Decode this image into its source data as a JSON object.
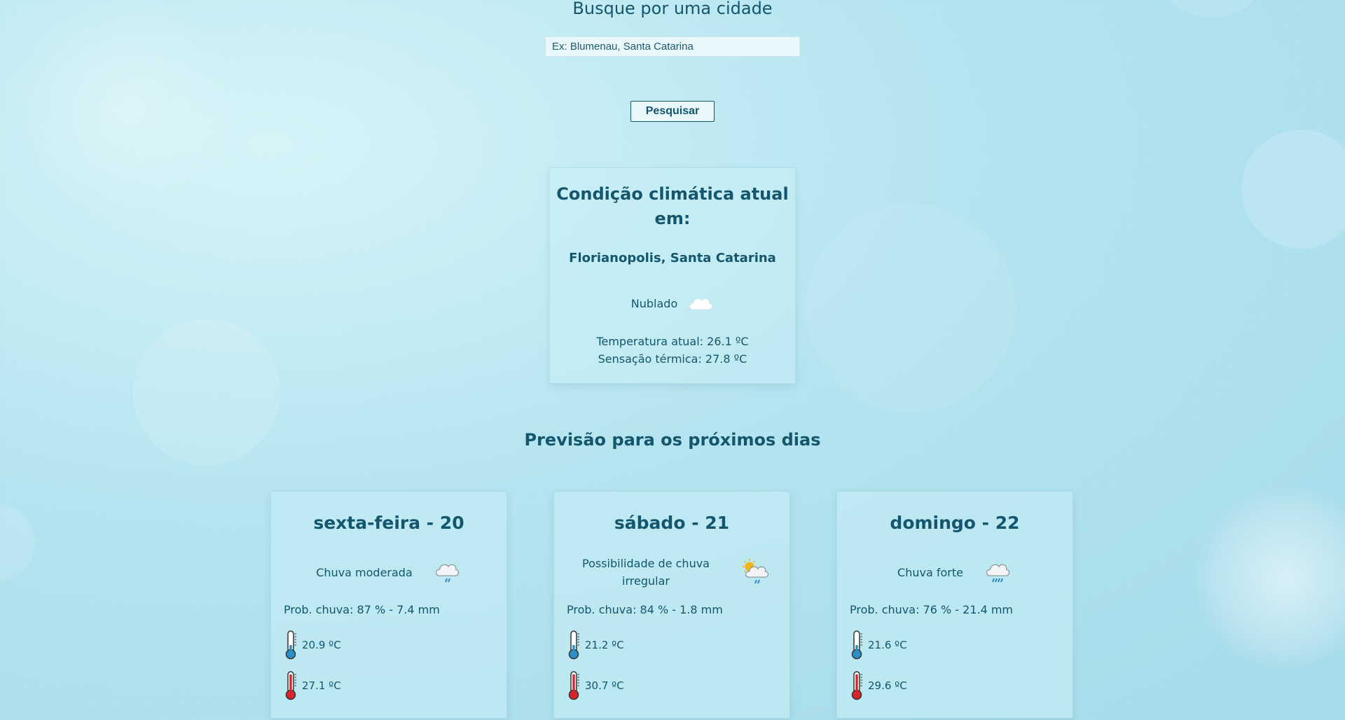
{
  "search": {
    "title": "Busque por uma cidade",
    "placeholder": "Ex: Blumenau, Santa Catarina",
    "button_label": "Pesquisar"
  },
  "current": {
    "title_line1": "Condição climática atual",
    "title_line2": "em:",
    "location": "Florianopolis, Santa Catarina",
    "condition": "Nublado",
    "condition_icon": "cloud-icon",
    "temperature": "Temperatura atual: 26.1 ºC",
    "feels_like": "Sensação térmica: 27.8 ºC"
  },
  "forecast": {
    "title": "Previsão para os próximos dias",
    "days": [
      {
        "title": "sexta-feira - 20",
        "condition": "Chuva moderada",
        "condition_icon": "rain-cloud-icon",
        "rain": "Prob. chuva: 87 % - 7.4 mm",
        "min": "20.9 ºC",
        "max": "27.1 ºC"
      },
      {
        "title": "sábado - 21",
        "condition": "Possibilidade de chuva irregular",
        "condition_icon": "sun-rain-cloud-icon",
        "rain": "Prob. chuva: 84 % - 1.8 mm",
        "min": "21.2 ºC",
        "max": "30.7 ºC"
      },
      {
        "title": "domingo - 22",
        "condition": "Chuva forte",
        "condition_icon": "heavy-rain-cloud-icon",
        "rain": "Prob. chuva: 76 % - 21.4 mm",
        "min": "21.6 ºC",
        "max": "29.6 ºC"
      }
    ]
  },
  "colors": {
    "text": "#13566e",
    "thermometer_cold": "#2a8fc9",
    "thermometer_hot": "#d6262b",
    "rain_drops": "#2e86c9",
    "sun": "#f2b515"
  }
}
